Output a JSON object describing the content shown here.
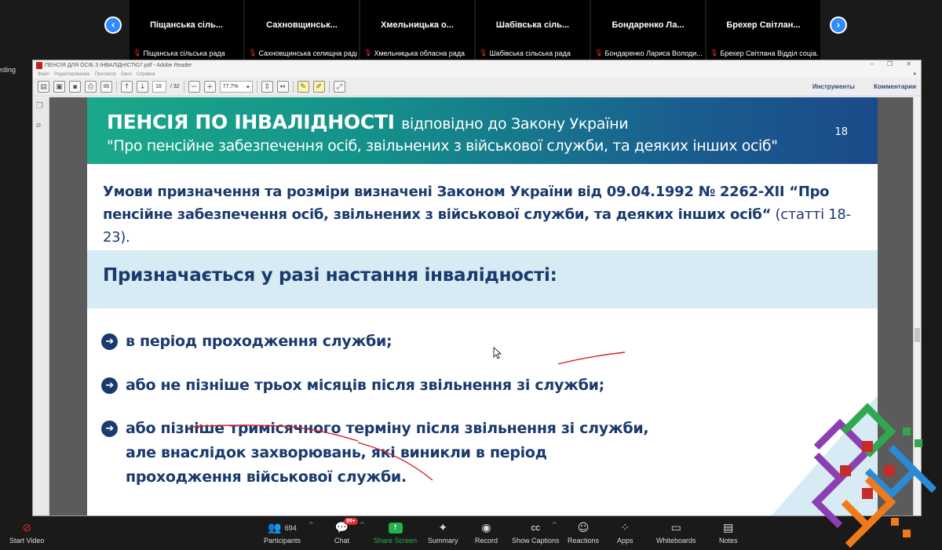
{
  "participants_strip": {
    "tiles": [
      {
        "name": "Піщанська сіль...",
        "sub": "Піщанська сільська рада"
      },
      {
        "name": "Сахновщинськ...",
        "sub": "Сахновщинська селищна рада"
      },
      {
        "name": "Хмельницька о...",
        "sub": "Хмельницька обласна рада"
      },
      {
        "name": "Шабівська сіль...",
        "sub": "Шабівська сільська рада"
      },
      {
        "name": "Бондаренко Ла...",
        "sub": "Бондаренко Лариса Володи..."
      },
      {
        "name": "Брехер Світлан...",
        "sub": "Брехер Світлана Відділ соціа..."
      }
    ],
    "prev_icon": "chevron-left-icon",
    "next_icon": "chevron-right-icon",
    "side_label": "rding"
  },
  "reader": {
    "title": "ПЕНСІЯ ДЛЯ ОСІБ З ІНВАЛІДНІСТЮ7.pdf - Adobe Reader",
    "menu": [
      "Файл",
      "Редактирование",
      "Просмотр",
      "Окно",
      "Справка"
    ],
    "page_current": "18",
    "page_total": "/ 32",
    "zoom": "77,7%",
    "tools_label": "Инструменты",
    "comments_label": "Комментарии"
  },
  "slide": {
    "title_bold": "ПЕНСІЯ ПО ІНВАЛІДНОСТІ",
    "title_rest": "відповідно до Закону України",
    "title_line2": "\"Про пенсійне забезпечення осіб, звільнених з військової служби, та деяких інших осіб\"",
    "page_number": "18",
    "intro_bold": "Умови призначення та розміри визначені Законом України від 09.04.1992 № 2262-XII “Про пенсійне забезпечення осіб, звільнених з військової служби, та деяких інших осіб“",
    "intro_light": " (статті 18-23).",
    "band_heading": "Призначається у разі настання інвалідності:",
    "bullets": [
      "в період проходження служби;",
      "або не пізніше трьох місяців після звільнення зі служби;",
      "або пізніше тримісячного терміну після звільнення зі служби, але внаслідок захворювань, які виникли в період проходження військової служби."
    ]
  },
  "controls": {
    "start_video": "Start Video",
    "participants_count": "694",
    "participants": "Participants",
    "chat": "Chat",
    "chat_badge": "99+",
    "share_screen": "Share Screen",
    "summary": "Summary",
    "record": "Record",
    "show_captions": "Show Captions",
    "reactions": "Reactions",
    "apps": "Apps",
    "whiteboards": "Whiteboards",
    "notes": "Notes"
  },
  "colors": {
    "zoom_bg": "#1a1a1a",
    "zoom_blue": "#2d8cff",
    "share_green": "#23b14d",
    "slide_navy": "#1a3a6e",
    "band_blue": "#d6ebf3",
    "ink_red": "#d0202a"
  }
}
